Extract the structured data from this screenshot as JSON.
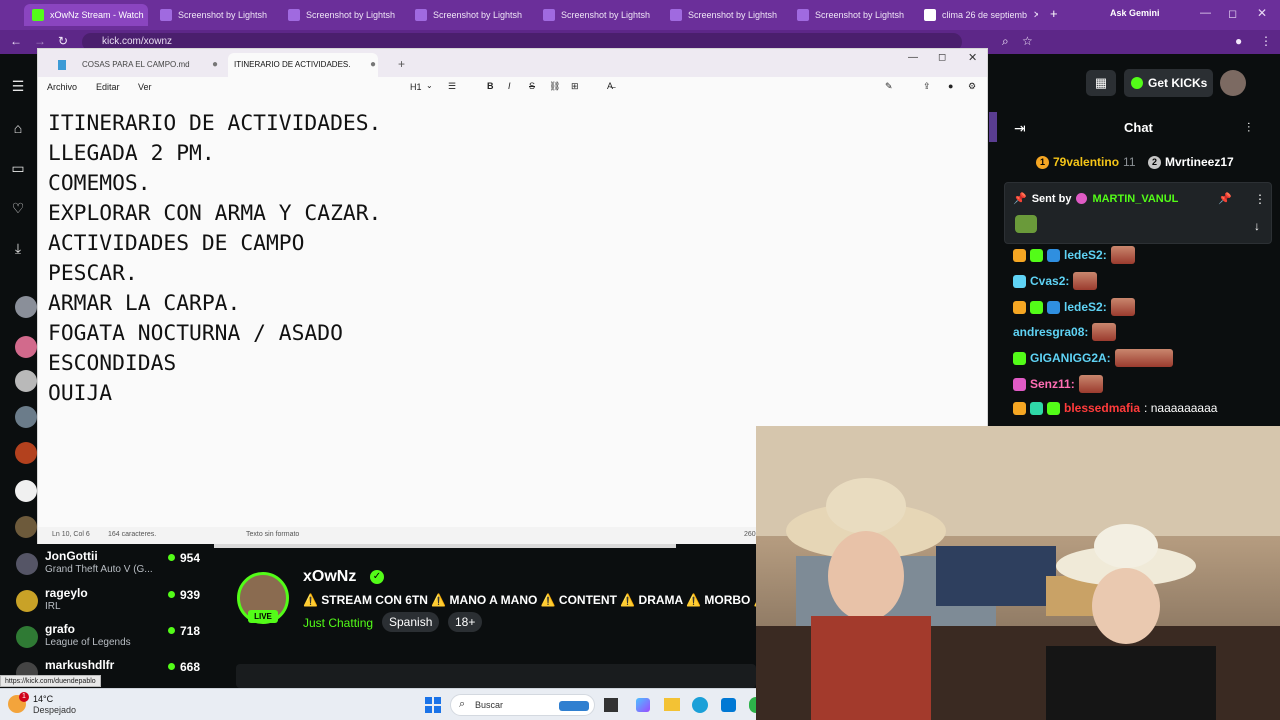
{
  "browser": {
    "tabs": [
      {
        "title": "xOwNz Stream - Watch",
        "fav": "#53fc18"
      },
      {
        "title": "Screenshot by Lightsh",
        "fav": "#a06ae0"
      },
      {
        "title": "Screenshot by Lightsh",
        "fav": "#a06ae0"
      },
      {
        "title": "Screenshot by Lightsh",
        "fav": "#a06ae0"
      },
      {
        "title": "Screenshot by Lightsh",
        "fav": "#a06ae0"
      },
      {
        "title": "Screenshot by Lightsh",
        "fav": "#a06ae0"
      },
      {
        "title": "Screenshot by Lightsh",
        "fav": "#a06ae0"
      },
      {
        "title": "clima 26 de septiemb",
        "fav": "#ffffff"
      }
    ],
    "new_tab": "+",
    "ask_gemini": "Ask Gemini",
    "url": "kick.com/xownz",
    "status_url": "https://kick.com/duendepablo"
  },
  "notepad": {
    "tabs": [
      "COSAS PARA EL CAMPO.md",
      "ITINERARIO DE ACTIVIDADES."
    ],
    "menu": [
      "Archivo",
      "Editar",
      "Ver"
    ],
    "heading_select": "H1",
    "lines": [
      "ITINERARIO DE ACTIVIDADES.",
      "LLEGADA 2 PM.",
      "COMEMOS.",
      "EXPLORAR CON ARMA Y CAZAR.",
      "ACTIVIDADES DE CAMPO",
      "PESCAR.",
      "ARMAR LA CARPA.",
      "FOGATA NOCTURNA / ASADO",
      "ESCONDIDAS",
      "OUIJA"
    ],
    "status_pos": "Ln 10, Col 6",
    "status_chars": "164 caracteres.",
    "status_format": "Texto sin formato",
    "status_zoom": "260"
  },
  "kick": {
    "get_kicks": "Get KICKs",
    "chat_title": "Chat",
    "top_gifters": [
      {
        "name": "79valentino",
        "count": "11",
        "rank": "1"
      },
      {
        "name": "Mvrtineez17",
        "count": "",
        "rank": "2"
      }
    ],
    "pinned": {
      "label": "Sent by",
      "user": "MARTIN_VANUL"
    },
    "messages": [
      {
        "user": "Cvas2:",
        "color": "#5fd3f5",
        "text": ""
      },
      {
        "user": "ledeS2:",
        "color": "#5fd3f5",
        "text": ""
      },
      {
        "user": "Cvas2:",
        "color": "#5fd3f5",
        "text": ""
      },
      {
        "user": "ledeS2:",
        "color": "#5fd3f5",
        "text": ""
      },
      {
        "user": "andresgra08:",
        "color": "#5fd3f5",
        "text": ""
      },
      {
        "user": "GIGANIGG2A:",
        "color": "#5fd3f5",
        "text": ""
      },
      {
        "user": "Senz11:",
        "color": "#ff6eb4",
        "text": ""
      },
      {
        "user": "blessedmafia",
        "color": "#ff3b3b",
        "text": ": naaaaaaaaa"
      }
    ],
    "channels": [
      {
        "name": "JonGottii",
        "game": "Grand Theft Auto V (G...",
        "viewers": "954",
        "color": "#556"
      },
      {
        "name": "rageylo",
        "game": "IRL",
        "viewers": "939",
        "color": "#c9a227"
      },
      {
        "name": "grafo",
        "game": "League of Legends",
        "viewers": "718",
        "color": "#2f7a34"
      },
      {
        "name": "markushdlfr",
        "game": "",
        "viewers": "668",
        "color": "#444"
      }
    ],
    "streamer": {
      "name": "xOwNz",
      "live": "LIVE",
      "title": "⚠️ STREAM CON 6TN ⚠️ MANO A MANO ⚠️ CONTENT ⚠️ DRAMA ⚠️ MORBO ⚠️",
      "category": "Just Chatting",
      "tags": [
        "Spanish",
        "18+"
      ]
    }
  },
  "taskbar": {
    "weather_temp": "14°C",
    "weather_desc": "Despejado",
    "search": "Buscar",
    "notif_count": "1"
  }
}
